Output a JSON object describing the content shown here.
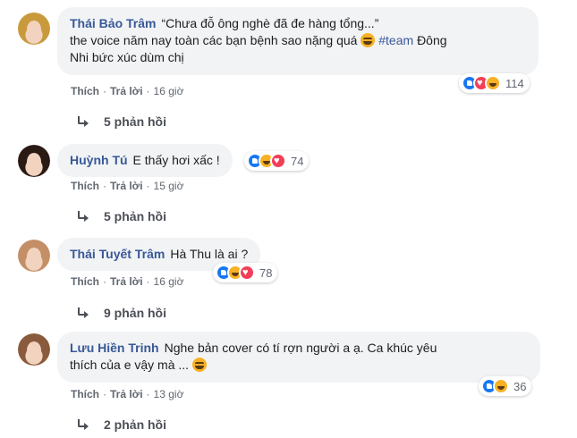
{
  "actions": {
    "like_label": "Thích",
    "reply_label": "Trả lời",
    "separator": "·"
  },
  "comments": [
    {
      "author": "Thái Bảo Trâm",
      "text_part1": "“Chưa đỗ ông nghè đã đe hàng tổng...”",
      "text_part2": "the voice năm nay toàn các bạn bệnh sao nặng quá",
      "emoji": "rolling-on-floor-laughing-emoji",
      "hashtag": "#team",
      "text_part3": "Đông",
      "text_part4": "Nhi bức xúc dùm chị",
      "reaction_count": "114",
      "reaction_icons": [
        "like",
        "love",
        "haha"
      ],
      "time": "16 giờ",
      "replies_label": "5 phản hồi"
    },
    {
      "author": "Huỳnh Tú",
      "text": "E thấy hơi xấc !",
      "reaction_count": "74",
      "reaction_icons": [
        "like",
        "haha",
        "love"
      ],
      "time": "15 giờ",
      "replies_label": "5 phản hồi"
    },
    {
      "author": "Thái Tuyết Trâm",
      "text": "Hà Thu là ai ?",
      "reaction_count": "78",
      "reaction_icons": [
        "like",
        "haha",
        "love"
      ],
      "time": "16 giờ",
      "replies_label": "9 phản hồi"
    },
    {
      "author": "Lưu Hiền Trinh",
      "text_part1": "Nghe bản cover có tí rợn người a ạ. Ca khúc yêu",
      "text_part2": "thích của e vậy mà ...",
      "emoji": "grinning-face-emoji",
      "reaction_count": "36",
      "reaction_icons": [
        "like",
        "haha"
      ],
      "time": "13 giờ",
      "replies_label": "2 phản hồi"
    }
  ],
  "colors": {
    "author": "#385898",
    "bubble": "#f2f3f5",
    "meta": "#606770",
    "like": "#1877f2",
    "love": "#f33e58",
    "haha": "#f7b125"
  }
}
